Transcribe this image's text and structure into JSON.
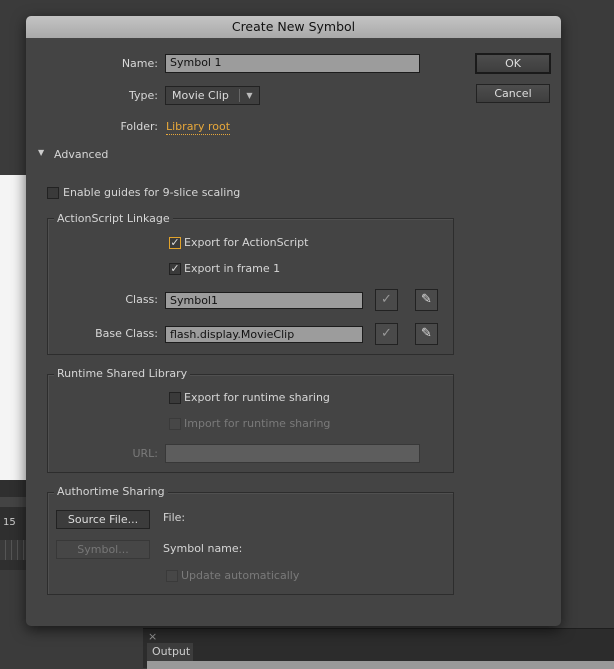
{
  "background": {
    "timeline_label": "15"
  },
  "dialog": {
    "title": "Create New Symbol",
    "name": {
      "label": "Name:",
      "value": "Symbol 1"
    },
    "type": {
      "label": "Type:",
      "value": "Movie Clip"
    },
    "folder": {
      "label": "Folder:",
      "value": "Library root"
    },
    "ok_label": "OK",
    "cancel_label": "Cancel",
    "advanced_label": "Advanced",
    "nine_slice": {
      "label": "Enable guides for 9-slice scaling",
      "checked": false
    },
    "linkage": {
      "title": "ActionScript Linkage",
      "export_as": {
        "label": "Export for ActionScript",
        "checked": true
      },
      "export_frame1": {
        "label": "Export in frame 1",
        "checked": true
      },
      "class": {
        "label": "Class:",
        "value": "Symbol1"
      },
      "base_class": {
        "label": "Base Class:",
        "value": "flash.display.MovieClip"
      },
      "check_glyph": "✓",
      "pencil_glyph": "✎"
    },
    "runtime": {
      "title": "Runtime Shared Library",
      "export_label": "Export for runtime sharing",
      "import_label": "Import for runtime sharing",
      "url_label": "URL:",
      "url_value": ""
    },
    "authortime": {
      "title": "Authortime Sharing",
      "source_file_label": "Source File...",
      "file_label": "File:",
      "symbol_label": "Symbol...",
      "symbol_name_label": "Symbol name:",
      "update_label": "Update automatically"
    }
  },
  "output_panel": {
    "close": "×",
    "tab": "Output"
  },
  "colors": {
    "link": "#e8a83a",
    "focus": "#e2a32b"
  }
}
